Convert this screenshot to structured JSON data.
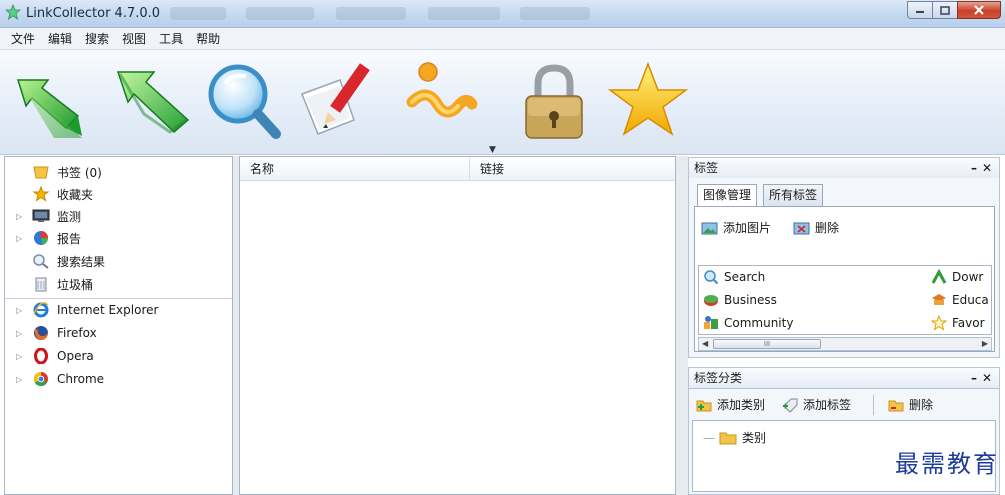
{
  "window": {
    "title": "LinkCollector 4.7.0.0",
    "controls": {
      "minimize": "minimize-icon",
      "maximize": "maximize-icon",
      "close": "close-icon"
    }
  },
  "menu": [
    {
      "label": "文件"
    },
    {
      "label": "编辑"
    },
    {
      "label": "搜索"
    },
    {
      "label": "视图"
    },
    {
      "label": "工具"
    },
    {
      "label": "帮助"
    }
  ],
  "toolbar": {
    "buttons": [
      {
        "icon": "import-green-arrow-icon"
      },
      {
        "icon": "export-green-arrow-icon"
      },
      {
        "icon": "search-magnifier-icon"
      },
      {
        "icon": "edit-pencil-icon"
      },
      {
        "icon": "info-icon",
        "has_dropdown": true
      },
      {
        "icon": "padlock-icon"
      },
      {
        "icon": "favorite-star-icon"
      }
    ]
  },
  "left_tree": {
    "items": [
      {
        "label": "书签 (0)",
        "icon": "bookmark-folder-icon",
        "expandable": false
      },
      {
        "label": "收藏夹",
        "icon": "favorites-star-icon",
        "expandable": false
      },
      {
        "label": "监测",
        "icon": "monitor-icon",
        "expandable": true
      },
      {
        "label": "报告",
        "icon": "report-pie-icon",
        "expandable": true
      },
      {
        "label": "搜索结果",
        "icon": "search-results-icon",
        "expandable": false
      },
      {
        "label": "垃圾桶",
        "icon": "trash-icon",
        "expandable": false
      }
    ],
    "browsers": [
      {
        "label": "Internet Explorer",
        "icon": "ie-icon",
        "expandable": true
      },
      {
        "label": "Firefox",
        "icon": "firefox-icon",
        "expandable": true
      },
      {
        "label": "Opera",
        "icon": "opera-icon",
        "expandable": true
      },
      {
        "label": "Chrome",
        "icon": "chrome-icon",
        "expandable": true
      }
    ]
  },
  "center": {
    "columns": [
      {
        "label": "名称"
      },
      {
        "label": "链接"
      }
    ],
    "rows": []
  },
  "tags_panel": {
    "title": "标签",
    "tabs": [
      {
        "label": "图像管理",
        "active": true
      },
      {
        "label": "所有标签",
        "active": false
      }
    ],
    "actions": {
      "add_image": "添加图片",
      "delete": "删除"
    },
    "tag_items": [
      {
        "label": "Search",
        "icon": "search-tag-icon"
      },
      {
        "label": "Business",
        "icon": "business-tag-icon"
      },
      {
        "label": "Community",
        "icon": "community-tag-icon"
      },
      {
        "label": "Dowr",
        "icon": "download-tag-icon"
      },
      {
        "label": "Educa",
        "icon": "education-tag-icon"
      },
      {
        "label": "Favor",
        "icon": "favorite-tag-icon"
      }
    ],
    "scroll_thumb": "III"
  },
  "category_panel": {
    "title": "标签分类",
    "actions": {
      "add_category": "添加类别",
      "add_tag": "添加标签",
      "delete": "删除"
    },
    "tree": [
      {
        "label": "类别"
      }
    ]
  },
  "watermark": "最需教育",
  "colors": {
    "titlebar": "#c4d8f0",
    "close_button": "#c9402b",
    "pane_border": "#a7b5c7",
    "watermark": "#1e3c9c"
  }
}
